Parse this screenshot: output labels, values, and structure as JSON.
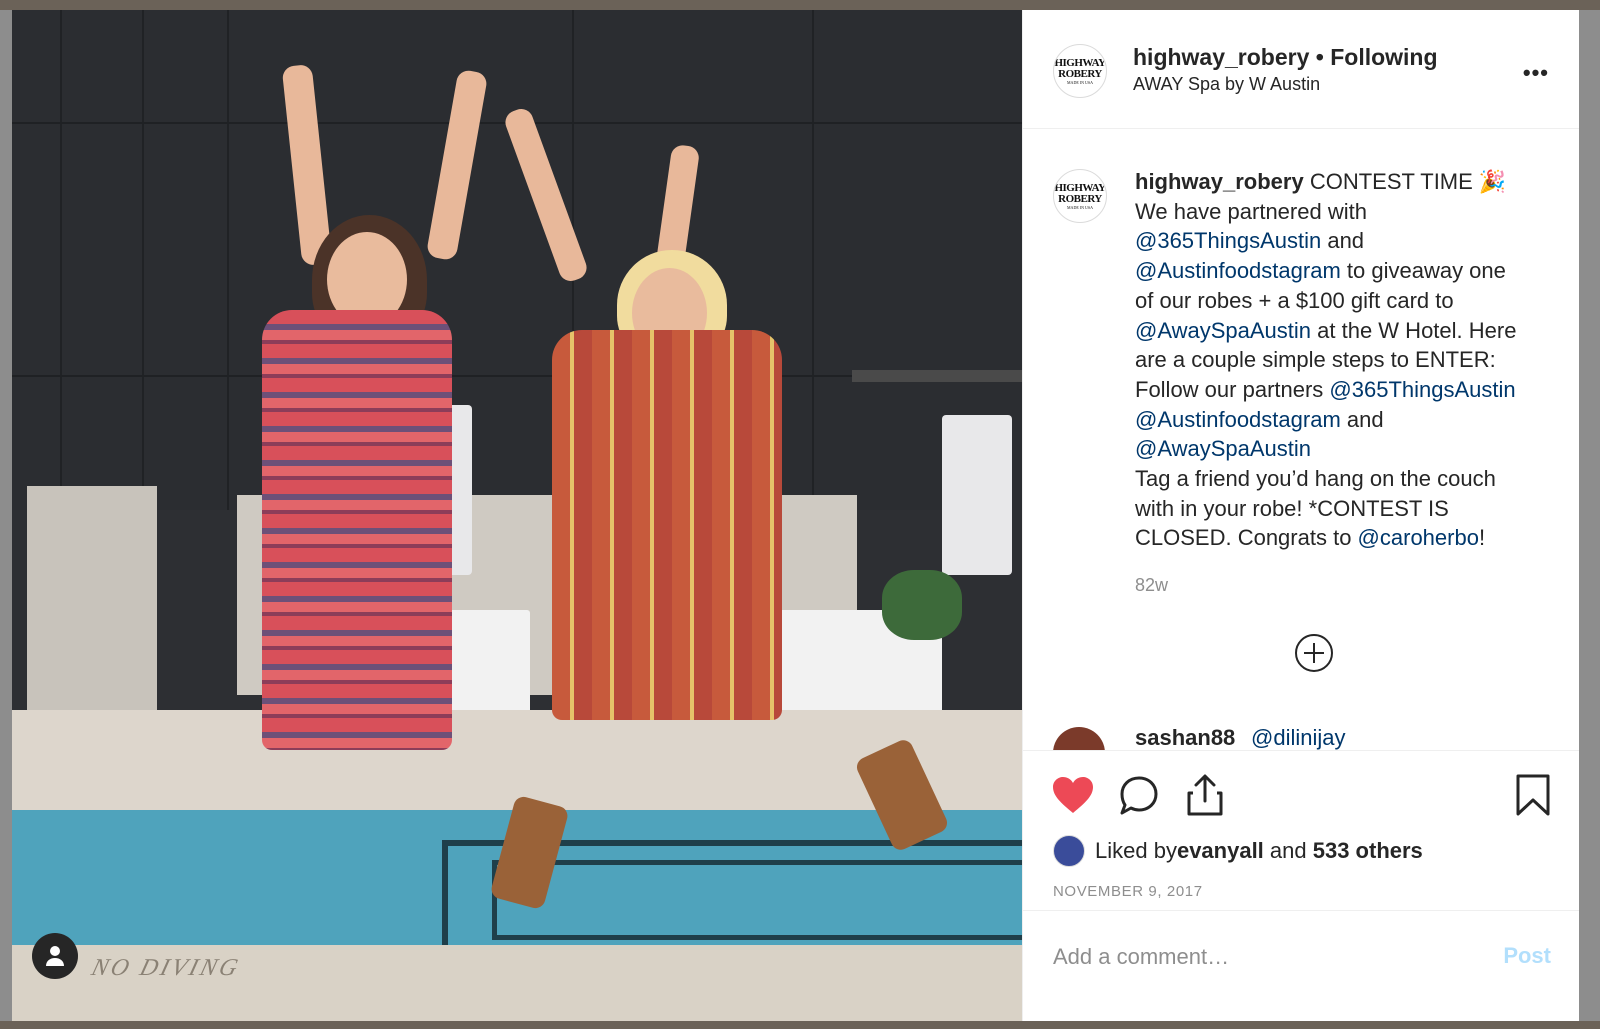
{
  "post": {
    "username": "highway_robery",
    "header_title": "highway_robery • Following",
    "location": "AWAY Spa by W Austin",
    "more_icon": "more-options-icon",
    "avatar_text": [
      "HIGHWAY",
      "ROBERY",
      "MADE IN USA"
    ]
  },
  "photo": {
    "sign_text": "NO DIVING"
  },
  "caption": {
    "username": "highway_robery",
    "segments": [
      {
        "t": "text",
        "v": " CONTEST TIME 🎉\nWe have partnered with\n"
      },
      {
        "t": "mention",
        "v": "@365ThingsAustin"
      },
      {
        "t": "text",
        "v": " and\n"
      },
      {
        "t": "mention",
        "v": "@Austinfoodstagram"
      },
      {
        "t": "text",
        "v": " to giveaway one\nof our robes + a $100 gift card to\n"
      },
      {
        "t": "mention",
        "v": "@AwaySpaAustin"
      },
      {
        "t": "text",
        "v": " at the W Hotel. Here\nare a couple simple steps to ENTER:\nFollow our partners "
      },
      {
        "t": "mention",
        "v": "@365ThingsAustin"
      },
      {
        "t": "text",
        "v": "\n"
      },
      {
        "t": "mention",
        "v": "@Austinfoodstagram"
      },
      {
        "t": "text",
        "v": " and\n"
      },
      {
        "t": "mention",
        "v": "@AwaySpaAustin"
      },
      {
        "t": "text",
        "v": "\nTag a friend you’d hang on the couch\nwith in your robe! *CONTEST IS\nCLOSED. Congrats to "
      },
      {
        "t": "mention",
        "v": "@caroherbo"
      },
      {
        "t": "text",
        "v": "!"
      }
    ],
    "age": "82w"
  },
  "next_comment": {
    "username": "sashan88",
    "mention": "@dilinijay"
  },
  "actions": {
    "liked_prefix": "Liked by ",
    "liked_user": "evanyall",
    "liked_mid": " and ",
    "liked_count": "533 others",
    "date": "NOVEMBER 9, 2017"
  },
  "comment_box": {
    "placeholder": "Add a comment…",
    "post_label": "Post"
  },
  "colors": {
    "heart": "#ed4956",
    "mention": "#00376b",
    "post_disabled": "#b2dffc"
  }
}
